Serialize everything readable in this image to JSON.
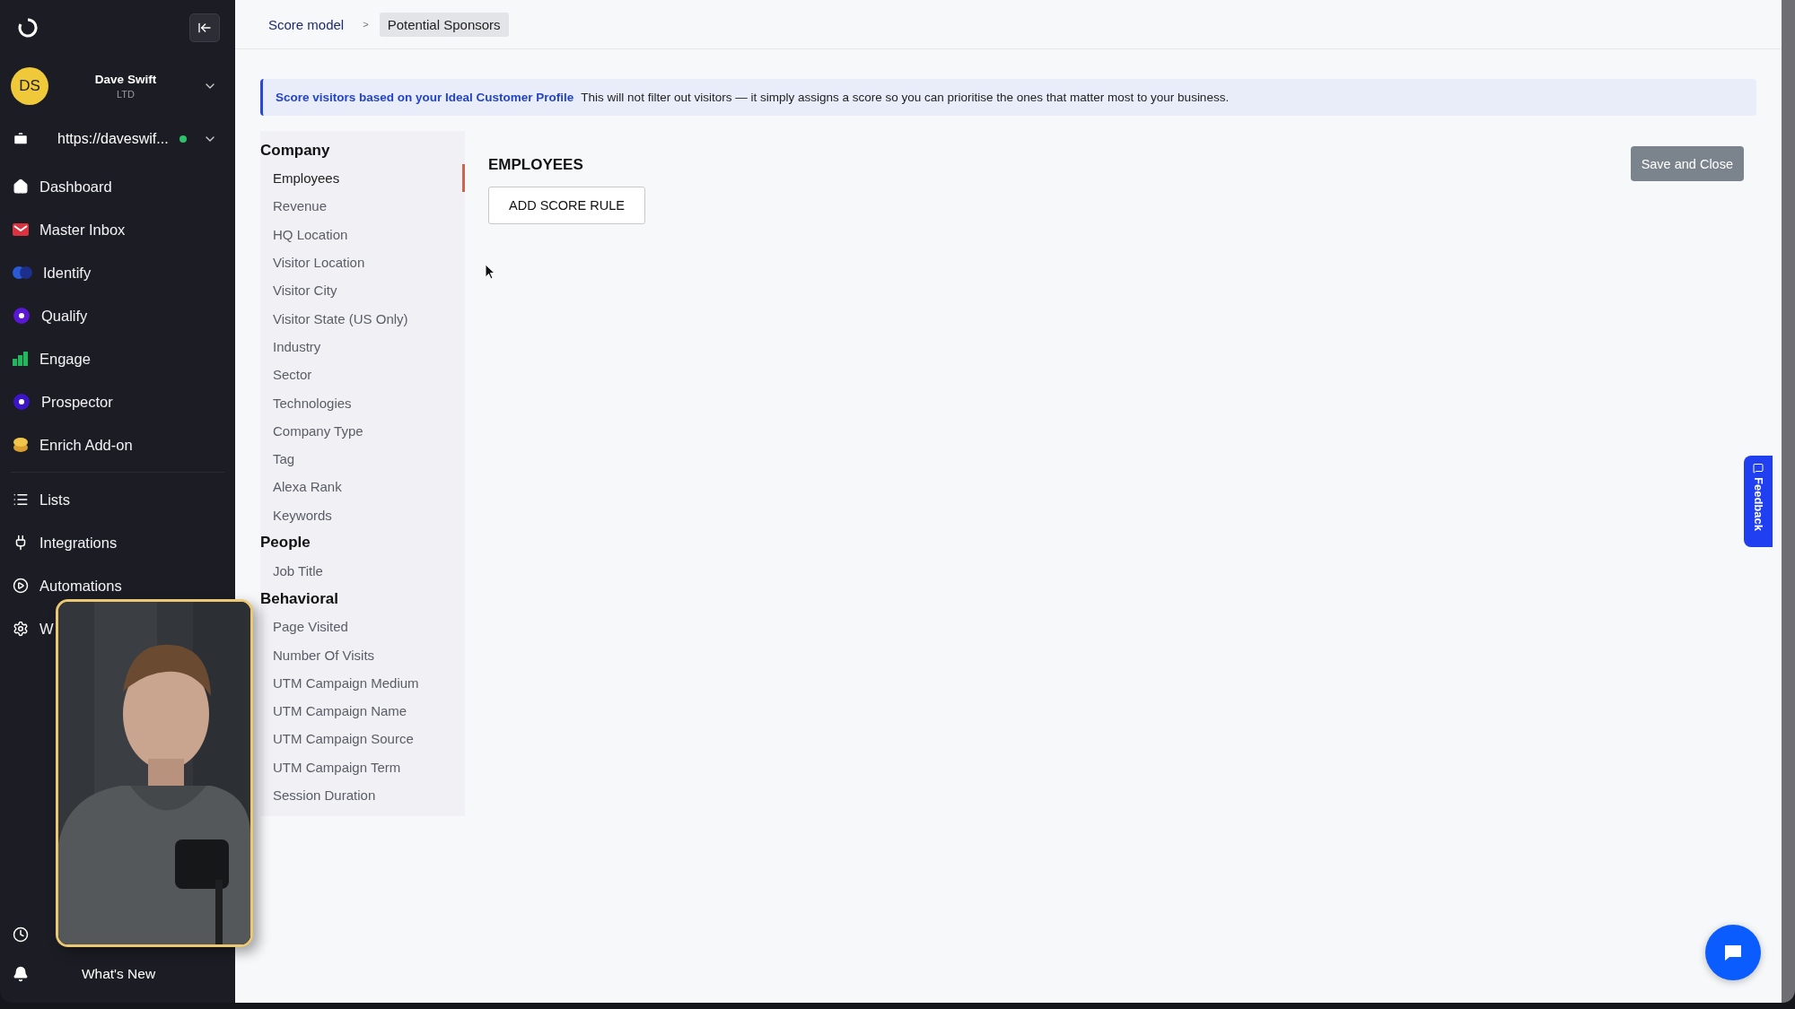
{
  "sidebar": {
    "user": {
      "initials": "DS",
      "name": "Dave Swift",
      "plan": "LTD"
    },
    "site": {
      "url": "https://daveswif...",
      "online": true
    },
    "nav": [
      {
        "kind": "home",
        "label": "Dashboard"
      },
      {
        "kind": "mail",
        "label": "Master Inbox"
      },
      {
        "kind": "identify",
        "label": "Identify"
      },
      {
        "kind": "qualify",
        "label": "Qualify"
      },
      {
        "kind": "engage",
        "label": "Engage"
      },
      {
        "kind": "prospector",
        "label": "Prospector"
      },
      {
        "kind": "enrich",
        "label": "Enrich Add-on"
      }
    ],
    "nav_secondary": [
      {
        "kind": "list",
        "label": "Lists"
      },
      {
        "kind": "plug",
        "label": "Integrations"
      },
      {
        "kind": "play",
        "label": "Automations"
      },
      {
        "kind": "gear",
        "label": "W"
      }
    ],
    "whats_new": "What's New"
  },
  "breadcrumb": [
    {
      "label": "Score model",
      "selected": false
    },
    {
      "label": "Potential Sponsors",
      "selected": true
    }
  ],
  "breadcrumb_separator": ">",
  "banner": {
    "title": "Score visitors based on your Ideal Customer Profile",
    "text": "This will not filter out visitors — it simply assigns a score so you can prioritise the ones that matter most to your business."
  },
  "categories": [
    {
      "title": "Company",
      "items": [
        {
          "label": "Employees",
          "selected": true
        },
        {
          "label": "Revenue",
          "selected": false
        },
        {
          "label": "HQ Location",
          "selected": false
        },
        {
          "label": "Visitor Location",
          "selected": false
        },
        {
          "label": "Visitor City",
          "selected": false
        },
        {
          "label": "Visitor State (US Only)",
          "selected": false
        },
        {
          "label": "Industry",
          "selected": false
        },
        {
          "label": "Sector",
          "selected": false
        },
        {
          "label": "Technologies",
          "selected": false
        },
        {
          "label": "Company Type",
          "selected": false
        },
        {
          "label": "Tag",
          "selected": false
        },
        {
          "label": "Alexa Rank",
          "selected": false
        },
        {
          "label": "Keywords",
          "selected": false
        }
      ]
    },
    {
      "title": "People",
      "items": [
        {
          "label": "Job Title",
          "selected": false
        }
      ]
    },
    {
      "title": "Behavioral",
      "items": [
        {
          "label": "Page Visited",
          "selected": false
        },
        {
          "label": "Number Of Visits",
          "selected": false
        },
        {
          "label": "UTM Campaign Medium",
          "selected": false
        },
        {
          "label": "UTM Campaign Name",
          "selected": false
        },
        {
          "label": "UTM Campaign Source",
          "selected": false
        },
        {
          "label": "UTM Campaign Term",
          "selected": false
        },
        {
          "label": "Session Duration",
          "selected": false
        }
      ]
    }
  ],
  "editor": {
    "heading": "EMPLOYEES",
    "add_button": "ADD SCORE RULE"
  },
  "save_button": "Save and Close",
  "feedback_tab": "Feedback"
}
